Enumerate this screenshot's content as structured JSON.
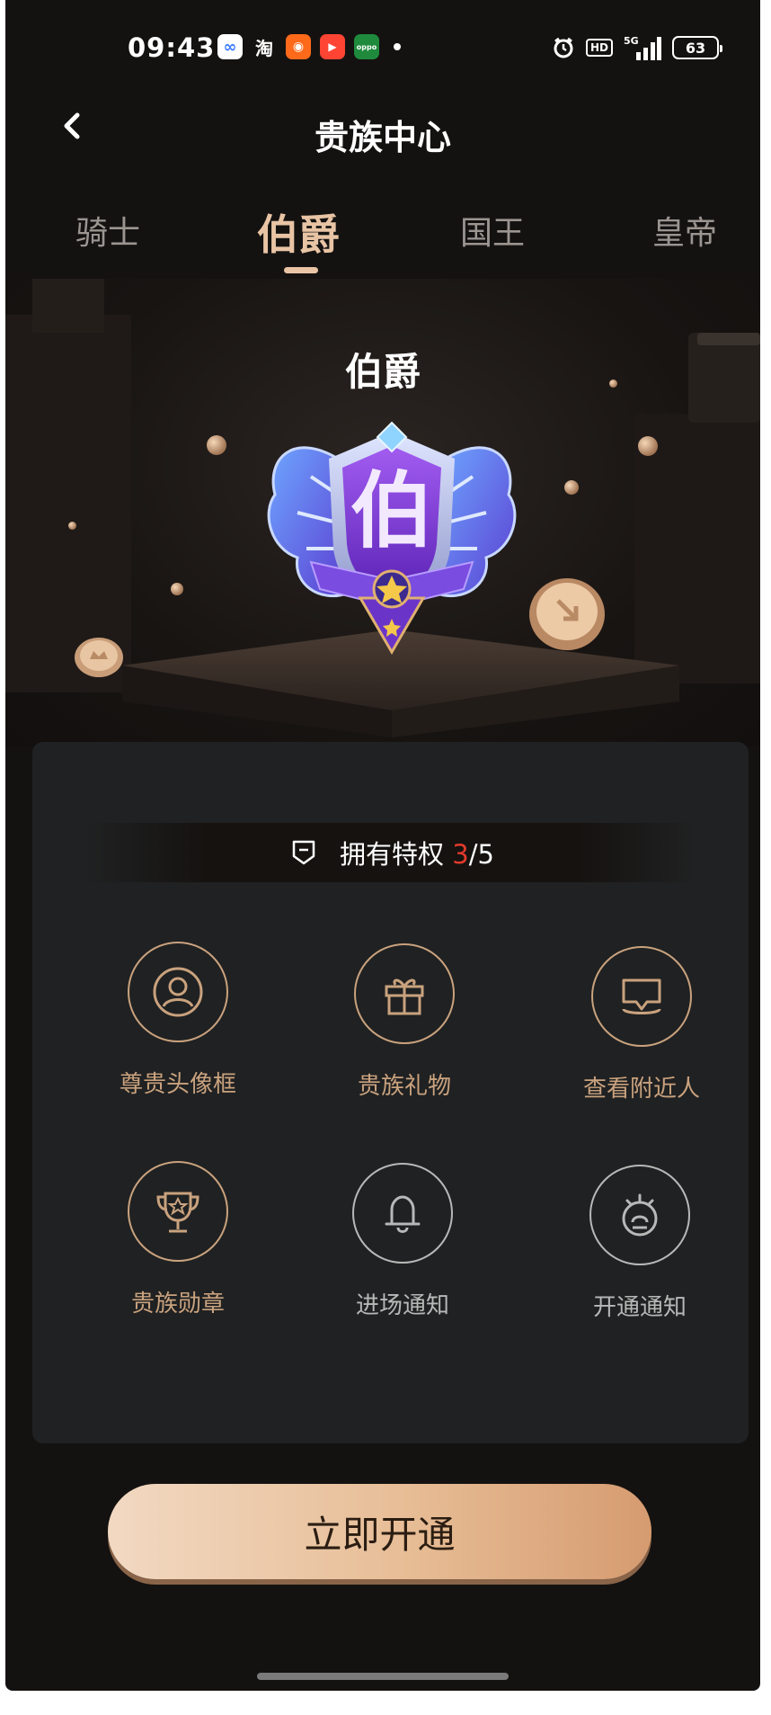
{
  "status_bar": {
    "time": "09:43",
    "apps": [
      {
        "name": "baidu-app",
        "glyph": "∞",
        "color": "#ffffff",
        "fg": "#3b7cff"
      },
      {
        "name": "taobao-app",
        "glyph": "淘",
        "color": "#141211",
        "fg": "#ffffff"
      },
      {
        "name": "kuaishou-app",
        "glyph": "◉",
        "color": "#ff6a1a",
        "fg": "#ffffff"
      },
      {
        "name": "video-app",
        "glyph": "▶",
        "color": "#ff4433",
        "fg": "#ffffff"
      },
      {
        "name": "oppo-app",
        "glyph": "oppo",
        "color": "#1f8a3c",
        "fg": "#ffffff"
      }
    ],
    "network": "5G",
    "hd": "HD",
    "battery": "63"
  },
  "header": {
    "title": "贵族中心"
  },
  "tabs": [
    {
      "label": "骑士",
      "active": false
    },
    {
      "label": "伯爵",
      "active": true
    },
    {
      "label": "国王",
      "active": false
    },
    {
      "label": "皇帝",
      "active": false
    }
  ],
  "hero": {
    "rank_title": "伯爵",
    "badge_character": "伯"
  },
  "privileges": {
    "label": "拥有特权",
    "owned": "3",
    "separator": "/",
    "total": "5"
  },
  "features": [
    {
      "label": "尊贵头像框",
      "icon": "avatar-frame-icon",
      "owned": true
    },
    {
      "label": "贵族礼物",
      "icon": "gift-icon",
      "owned": true
    },
    {
      "label": "查看附近人",
      "icon": "nearby-location-icon",
      "owned": true
    },
    {
      "label": "贵族勋章",
      "icon": "trophy-icon",
      "owned": true
    },
    {
      "label": "进场通知",
      "icon": "bell-icon",
      "owned": false
    },
    {
      "label": "开通通知",
      "icon": "siren-icon",
      "owned": false
    }
  ],
  "cta": {
    "label": "立即开通"
  },
  "colors": {
    "background": "#141211",
    "gold": "#c9a27e",
    "accent": "#e8c4a5",
    "highlight_red": "#e23a2c"
  }
}
